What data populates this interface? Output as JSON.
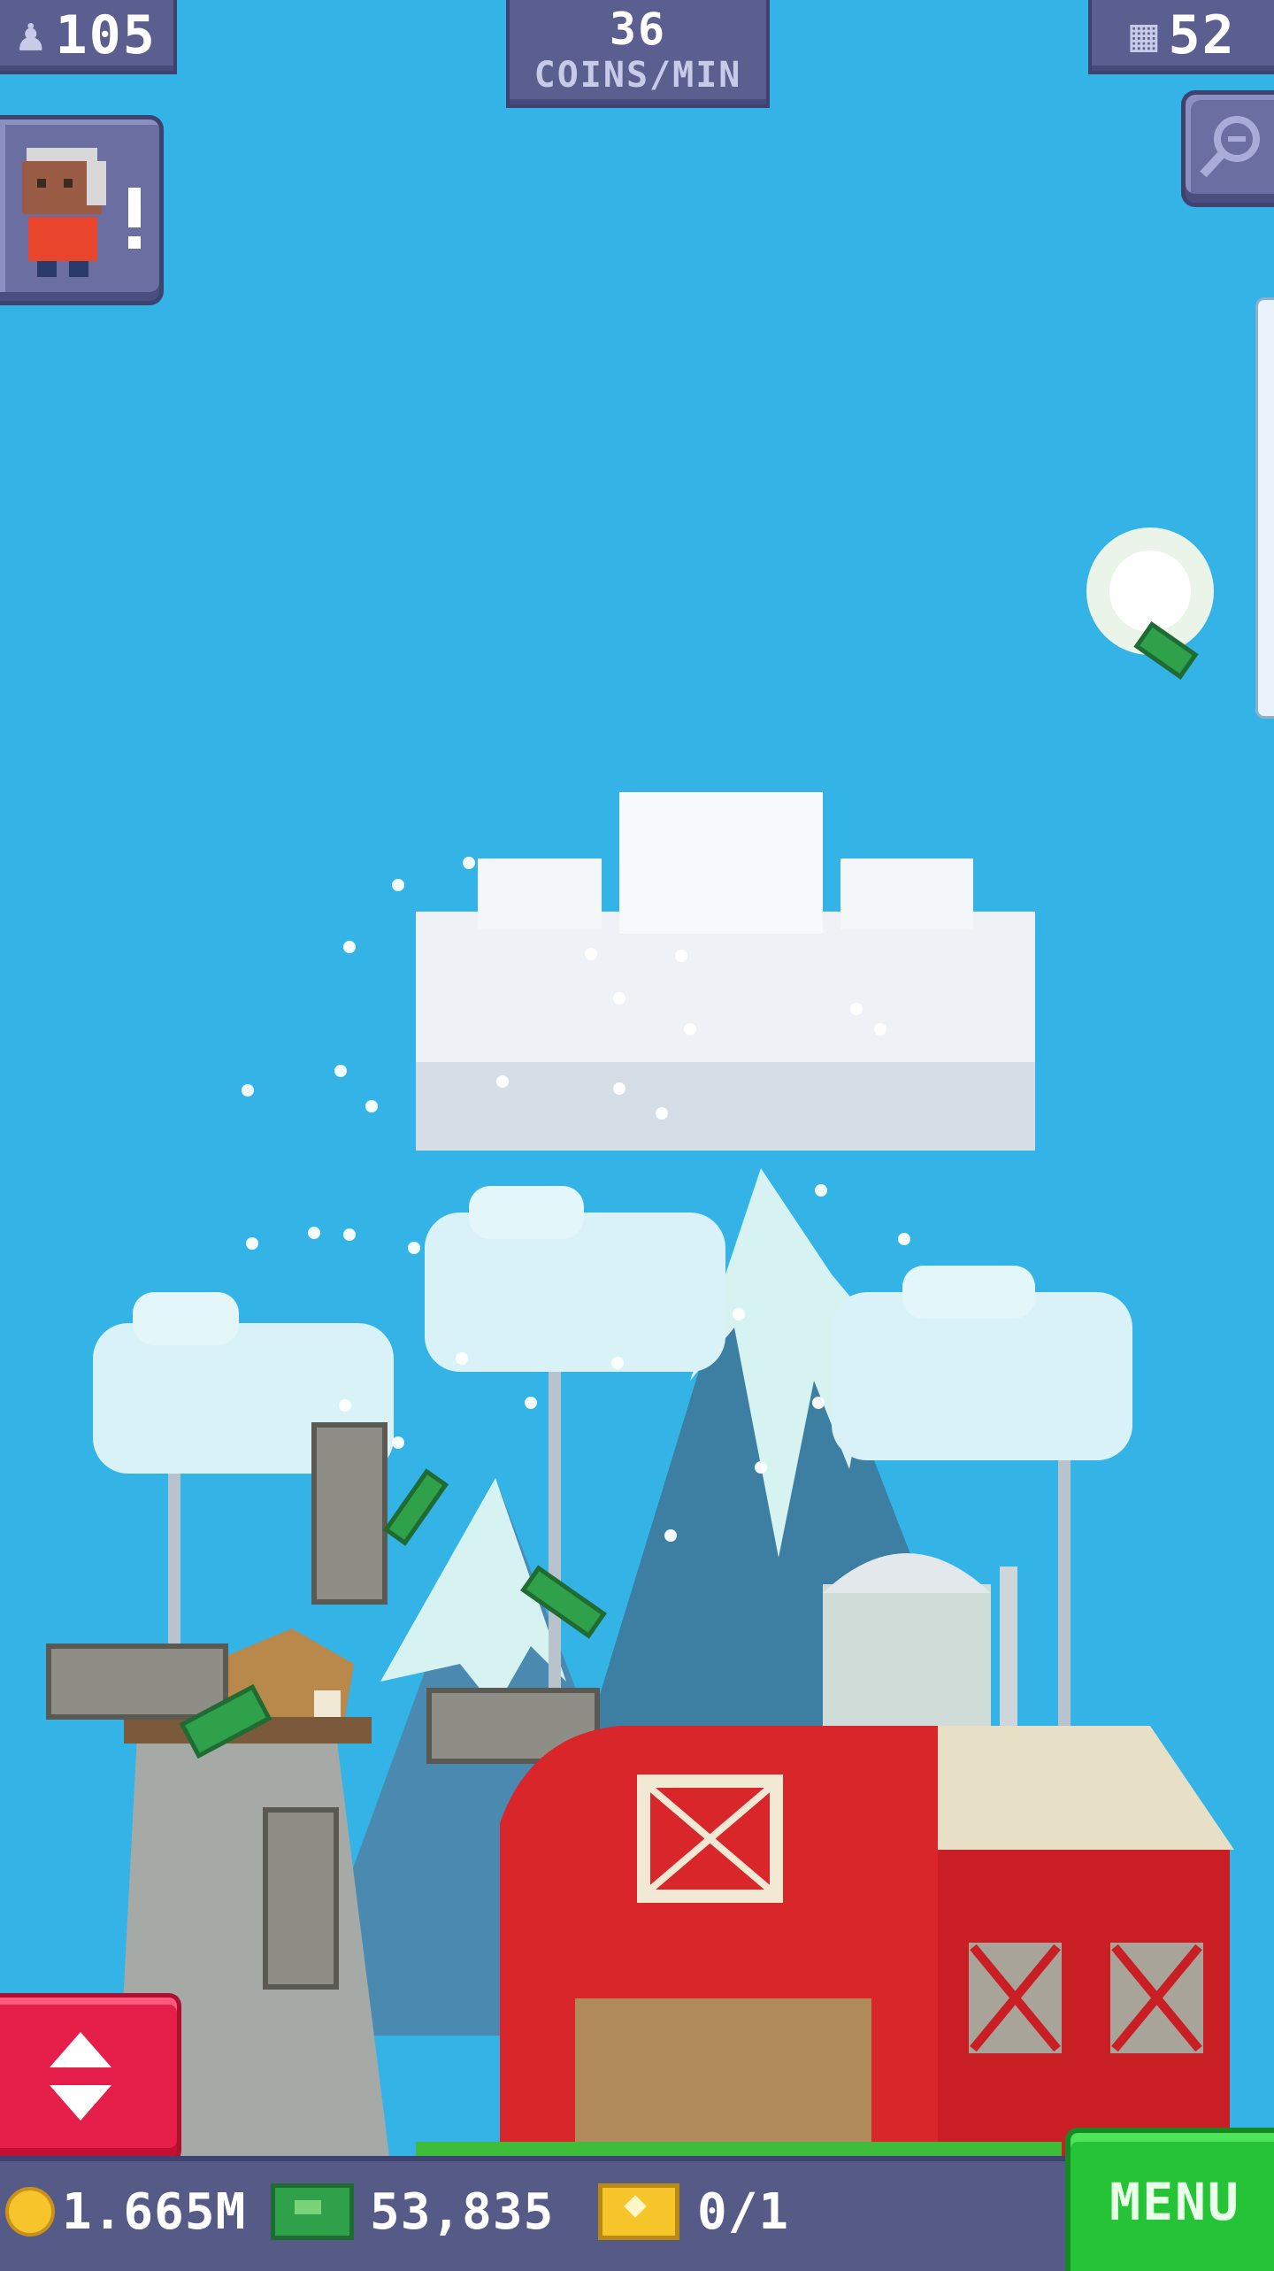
{
  "hud": {
    "population": "105",
    "coins_rate_value": "36",
    "coins_rate_unit": "COINS/MIN",
    "floors": "52"
  },
  "icons": {
    "population": "person-icon",
    "floors": "building-icon",
    "zoom": "magnifier-icon",
    "elevator": "up-down-arrows-icon",
    "coins": "coin-icon",
    "bux": "bux-icon",
    "tickets": "golden-ticket-icon"
  },
  "bottom_bar": {
    "coins": "1.665M",
    "bux": "53,835",
    "tickets": "0/1",
    "menu_label": "MENU"
  },
  "colors": {
    "sky": "#33b3e6",
    "hud": "#5a5f8f",
    "menu": "#25c436",
    "elevator": "#e61e4a",
    "barn": "#d8262a"
  }
}
